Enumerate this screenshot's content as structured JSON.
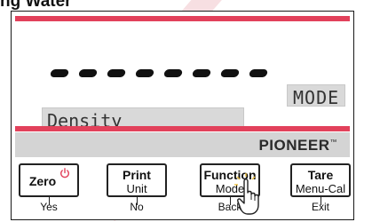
{
  "heading": "ng Water",
  "display": {
    "mode_label": "MODE",
    "function_label": "Density",
    "dash_count": 8
  },
  "brand": {
    "name": "PIONEER",
    "trademark": "™"
  },
  "buttons": [
    {
      "primary": "Zero",
      "secondary": "",
      "sub_label": "Yes",
      "icon": "power-icon"
    },
    {
      "primary": "Print",
      "secondary": "Unit",
      "sub_label": "No"
    },
    {
      "primary": "Function",
      "secondary": "Mode",
      "sub_label": "Back"
    },
    {
      "primary": "Tare",
      "secondary": "Menu-Cal",
      "sub_label": "Exit"
    }
  ],
  "colors": {
    "accent_stripe": "#e2415b",
    "power_icon": "#e2415b",
    "display_box": "#d9d9d9",
    "brand_bar": "#d4d4d4"
  }
}
